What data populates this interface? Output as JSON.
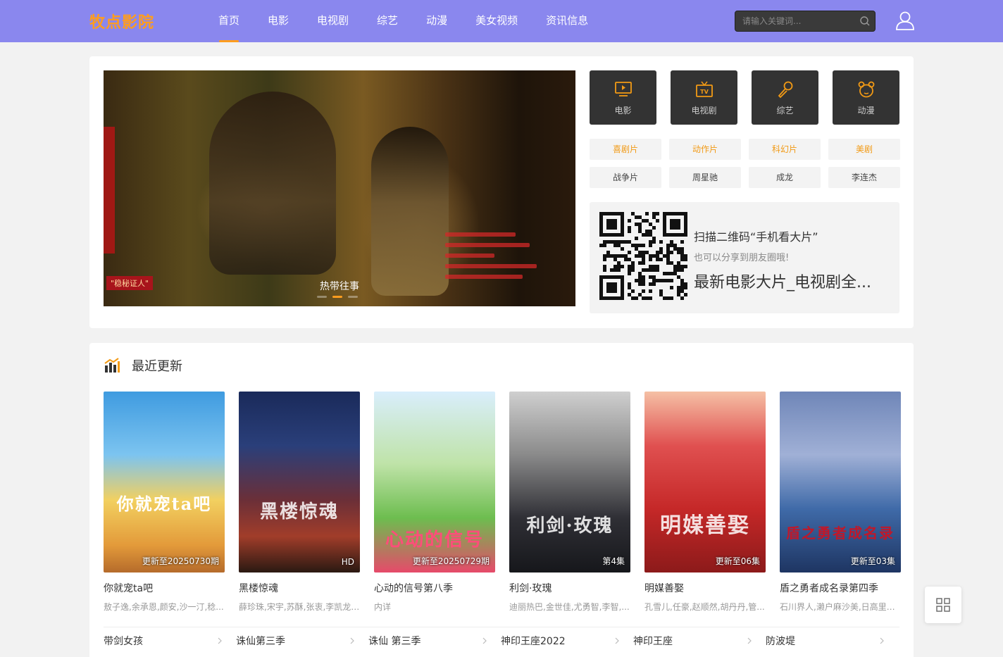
{
  "header": {
    "logo": "牧点影院",
    "nav": [
      "首页",
      "电影",
      "电视剧",
      "综艺",
      "动漫",
      "美女视频",
      "资讯信息"
    ],
    "active_nav": "首页",
    "search": {
      "placeholder": "请输入关键词..."
    },
    "colors": {
      "bar": "#8a87ee",
      "accent": "#ff9d1e"
    }
  },
  "banner": {
    "caption": "热带往事",
    "poster_label": "\"稳秘证人\"",
    "slide_count": 3,
    "active_slide": 2
  },
  "categories": [
    {
      "label": "电影",
      "icon": "tv-play-icon"
    },
    {
      "label": "电视剧",
      "icon": "tv-icon"
    },
    {
      "label": "综艺",
      "icon": "microphone-icon"
    },
    {
      "label": "动漫",
      "icon": "bear-icon"
    }
  ],
  "tags": [
    {
      "label": "喜剧片",
      "hot": true
    },
    {
      "label": "动作片",
      "hot": true
    },
    {
      "label": "科幻片",
      "hot": true
    },
    {
      "label": "美剧",
      "hot": true
    },
    {
      "label": "战争片",
      "hot": false
    },
    {
      "label": "周星驰",
      "hot": false
    },
    {
      "label": "成龙",
      "hot": false
    },
    {
      "label": "李连杰",
      "hot": false
    }
  ],
  "qr": {
    "title": "扫描二维码“手机看大片”",
    "subtitle": "也可以分享到朋友圈哦!",
    "site": "最新电影大片_电视剧全..."
  },
  "recent": {
    "title": "最近更新",
    "items": [
      {
        "title": "你就宠ta吧",
        "cast": "敖子逸,余承恩,颜安,沙一汀,稔...",
        "badge": "更新至20250730期",
        "poster_text": "你就宠ta吧"
      },
      {
        "title": "黑楼惊魂",
        "cast": "薛珍珠,宋宇,苏酥,张衷,李凯龙,...",
        "badge": "HD",
        "poster_text": "黑楼惊魂"
      },
      {
        "title": "心动的信号第八季",
        "cast": "内详",
        "badge": "更新至20250729期",
        "poster_text": "心动的信号"
      },
      {
        "title": "利剑·玫瑰",
        "cast": "迪丽热巴,金世佳,尤勇智,李智,...",
        "badge": "第4集",
        "poster_text": "利剑·玫瑰"
      },
      {
        "title": "明媒善娶",
        "cast": "孔雪儿,任豪,赵顺然,胡丹丹,管...",
        "badge": "更新至06集",
        "poster_text": "明媒善娶"
      },
      {
        "title": "盾之勇者成名录第四季",
        "cast": "石川界人,濑户麻沙美,日高里菜...",
        "badge": "更新至03集",
        "poster_text": "盾之勇者成名录"
      }
    ],
    "links": [
      "带剑女孩",
      "诛仙第三季",
      "诛仙 第三季",
      "神印王座2022",
      "神印王座",
      "防波堤"
    ]
  }
}
